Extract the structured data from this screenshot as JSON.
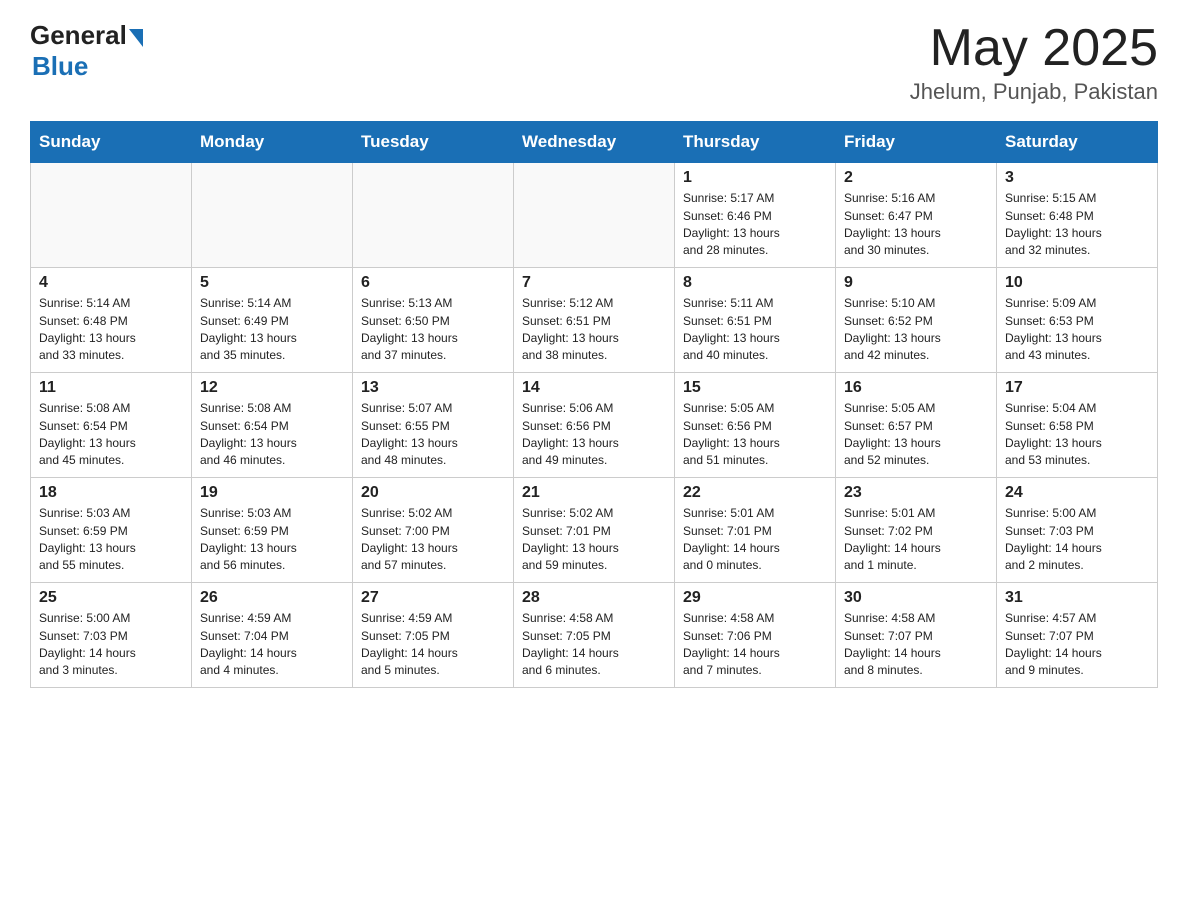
{
  "header": {
    "logo_general": "General",
    "logo_blue": "Blue",
    "month_year": "May 2025",
    "location": "Jhelum, Punjab, Pakistan"
  },
  "days_of_week": [
    "Sunday",
    "Monday",
    "Tuesday",
    "Wednesday",
    "Thursday",
    "Friday",
    "Saturday"
  ],
  "weeks": [
    [
      {
        "day": "",
        "info": ""
      },
      {
        "day": "",
        "info": ""
      },
      {
        "day": "",
        "info": ""
      },
      {
        "day": "",
        "info": ""
      },
      {
        "day": "1",
        "info": "Sunrise: 5:17 AM\nSunset: 6:46 PM\nDaylight: 13 hours\nand 28 minutes."
      },
      {
        "day": "2",
        "info": "Sunrise: 5:16 AM\nSunset: 6:47 PM\nDaylight: 13 hours\nand 30 minutes."
      },
      {
        "day": "3",
        "info": "Sunrise: 5:15 AM\nSunset: 6:48 PM\nDaylight: 13 hours\nand 32 minutes."
      }
    ],
    [
      {
        "day": "4",
        "info": "Sunrise: 5:14 AM\nSunset: 6:48 PM\nDaylight: 13 hours\nand 33 minutes."
      },
      {
        "day": "5",
        "info": "Sunrise: 5:14 AM\nSunset: 6:49 PM\nDaylight: 13 hours\nand 35 minutes."
      },
      {
        "day": "6",
        "info": "Sunrise: 5:13 AM\nSunset: 6:50 PM\nDaylight: 13 hours\nand 37 minutes."
      },
      {
        "day": "7",
        "info": "Sunrise: 5:12 AM\nSunset: 6:51 PM\nDaylight: 13 hours\nand 38 minutes."
      },
      {
        "day": "8",
        "info": "Sunrise: 5:11 AM\nSunset: 6:51 PM\nDaylight: 13 hours\nand 40 minutes."
      },
      {
        "day": "9",
        "info": "Sunrise: 5:10 AM\nSunset: 6:52 PM\nDaylight: 13 hours\nand 42 minutes."
      },
      {
        "day": "10",
        "info": "Sunrise: 5:09 AM\nSunset: 6:53 PM\nDaylight: 13 hours\nand 43 minutes."
      }
    ],
    [
      {
        "day": "11",
        "info": "Sunrise: 5:08 AM\nSunset: 6:54 PM\nDaylight: 13 hours\nand 45 minutes."
      },
      {
        "day": "12",
        "info": "Sunrise: 5:08 AM\nSunset: 6:54 PM\nDaylight: 13 hours\nand 46 minutes."
      },
      {
        "day": "13",
        "info": "Sunrise: 5:07 AM\nSunset: 6:55 PM\nDaylight: 13 hours\nand 48 minutes."
      },
      {
        "day": "14",
        "info": "Sunrise: 5:06 AM\nSunset: 6:56 PM\nDaylight: 13 hours\nand 49 minutes."
      },
      {
        "day": "15",
        "info": "Sunrise: 5:05 AM\nSunset: 6:56 PM\nDaylight: 13 hours\nand 51 minutes."
      },
      {
        "day": "16",
        "info": "Sunrise: 5:05 AM\nSunset: 6:57 PM\nDaylight: 13 hours\nand 52 minutes."
      },
      {
        "day": "17",
        "info": "Sunrise: 5:04 AM\nSunset: 6:58 PM\nDaylight: 13 hours\nand 53 minutes."
      }
    ],
    [
      {
        "day": "18",
        "info": "Sunrise: 5:03 AM\nSunset: 6:59 PM\nDaylight: 13 hours\nand 55 minutes."
      },
      {
        "day": "19",
        "info": "Sunrise: 5:03 AM\nSunset: 6:59 PM\nDaylight: 13 hours\nand 56 minutes."
      },
      {
        "day": "20",
        "info": "Sunrise: 5:02 AM\nSunset: 7:00 PM\nDaylight: 13 hours\nand 57 minutes."
      },
      {
        "day": "21",
        "info": "Sunrise: 5:02 AM\nSunset: 7:01 PM\nDaylight: 13 hours\nand 59 minutes."
      },
      {
        "day": "22",
        "info": "Sunrise: 5:01 AM\nSunset: 7:01 PM\nDaylight: 14 hours\nand 0 minutes."
      },
      {
        "day": "23",
        "info": "Sunrise: 5:01 AM\nSunset: 7:02 PM\nDaylight: 14 hours\nand 1 minute."
      },
      {
        "day": "24",
        "info": "Sunrise: 5:00 AM\nSunset: 7:03 PM\nDaylight: 14 hours\nand 2 minutes."
      }
    ],
    [
      {
        "day": "25",
        "info": "Sunrise: 5:00 AM\nSunset: 7:03 PM\nDaylight: 14 hours\nand 3 minutes."
      },
      {
        "day": "26",
        "info": "Sunrise: 4:59 AM\nSunset: 7:04 PM\nDaylight: 14 hours\nand 4 minutes."
      },
      {
        "day": "27",
        "info": "Sunrise: 4:59 AM\nSunset: 7:05 PM\nDaylight: 14 hours\nand 5 minutes."
      },
      {
        "day": "28",
        "info": "Sunrise: 4:58 AM\nSunset: 7:05 PM\nDaylight: 14 hours\nand 6 minutes."
      },
      {
        "day": "29",
        "info": "Sunrise: 4:58 AM\nSunset: 7:06 PM\nDaylight: 14 hours\nand 7 minutes."
      },
      {
        "day": "30",
        "info": "Sunrise: 4:58 AM\nSunset: 7:07 PM\nDaylight: 14 hours\nand 8 minutes."
      },
      {
        "day": "31",
        "info": "Sunrise: 4:57 AM\nSunset: 7:07 PM\nDaylight: 14 hours\nand 9 minutes."
      }
    ]
  ]
}
